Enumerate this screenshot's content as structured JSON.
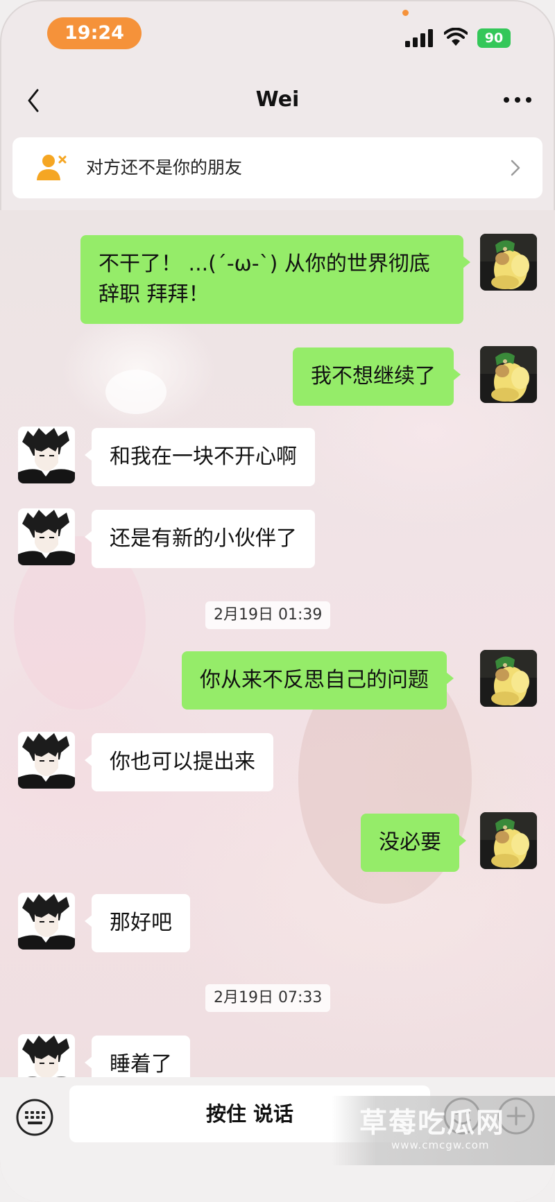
{
  "status_bar": {
    "time": "19:24",
    "battery": "90"
  },
  "nav": {
    "title": "Wei"
  },
  "banner": {
    "text": "对方还不是你的朋友"
  },
  "messages": [
    {
      "from": "me",
      "text_line1": "不干了！ ...(´-ω-`) 从你的世界彻底",
      "text_line2": "辞职 拜拜！"
    },
    {
      "from": "me",
      "text": "我不想继续了"
    },
    {
      "from": "them",
      "text": "和我在一块不开心啊"
    },
    {
      "from": "them",
      "text": "还是有新的小伙伴了"
    },
    {
      "from": "me",
      "text": "你从来不反思自己的问题"
    },
    {
      "from": "them",
      "text": "你也可以提出来"
    },
    {
      "from": "me",
      "text": "没必要"
    },
    {
      "from": "them",
      "text": "那好吧"
    },
    {
      "from": "them",
      "text": "睡着了"
    }
  ],
  "timestamps": [
    "2月19日 01:39",
    "2月19日 07:33"
  ],
  "input_bar": {
    "hold_to_talk": "按住 说话"
  },
  "watermark": {
    "title": "草莓吃瓜网",
    "url": "www.cmcgw.com"
  },
  "colors": {
    "sent_bubble": "#95ec69",
    "received_bubble": "#ffffff",
    "time_pill": "#f5923a",
    "battery": "#34c759"
  }
}
